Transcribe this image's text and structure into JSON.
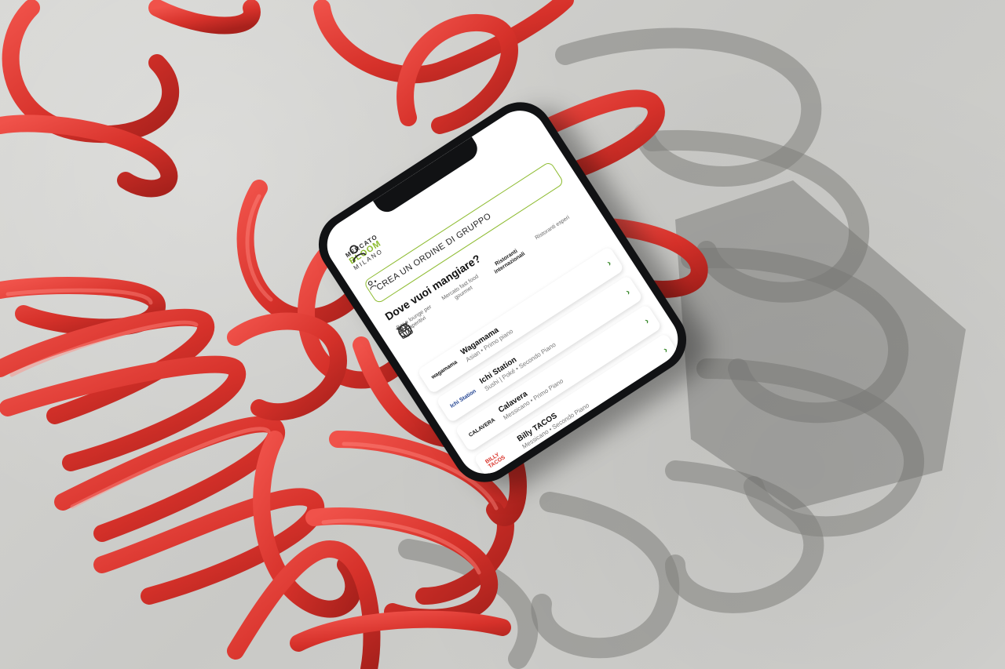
{
  "app": {
    "brand_top": "MERCATO",
    "brand_mid": "BLOOM",
    "brand_bot": "MILANO",
    "group_order_button": "CREA UN ORDINE DI GRUPPO",
    "section_title": "Dove vuoi mangiare?"
  },
  "categories": [
    {
      "label": "Bar e lounge per aperitivi",
      "icon": "cocktail-icon"
    },
    {
      "label": "Mercato fast food gourmet",
      "icon": "basket-icon"
    },
    {
      "label": "Ristoranti internazionali",
      "icon": "globe-icon"
    },
    {
      "label": "Ristoranti esperi",
      "icon": "cutlery-icon"
    }
  ],
  "restaurants": [
    {
      "name": "Wagamama",
      "meta": "Asian • Primo piano",
      "logo_text": "wagamama"
    },
    {
      "name": "Ichi Station",
      "meta": "Sushi | Poké • Secondo Piano",
      "logo_text": "Ichi Station"
    },
    {
      "name": "Calavera",
      "meta": "Messicano • Primo Piano",
      "logo_text": "CALAVERA"
    },
    {
      "name": "Billy TACOS",
      "meta": "Messicano • Secondo Piano",
      "logo_text": "BILLY TACOS"
    }
  ],
  "colors": {
    "accent": "#8dbb2f",
    "chevron": "#3c8a2e",
    "spring_red": "#d9342b",
    "concrete": "#cfcfcc"
  }
}
